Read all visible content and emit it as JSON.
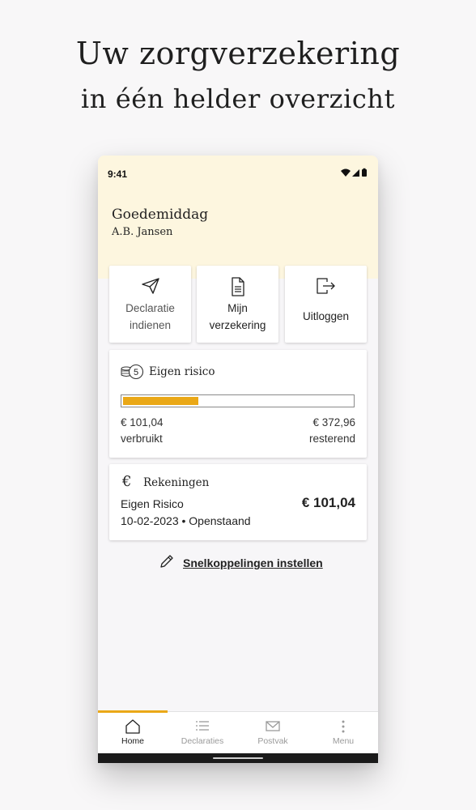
{
  "promo": {
    "line1": "Uw zorgverzekering",
    "line2": "in één helder overzicht"
  },
  "status_bar": {
    "time": "9:41",
    "icons": [
      "wifi-icon",
      "signal-icon",
      "battery-icon"
    ]
  },
  "header": {
    "greeting": "Goedemiddag",
    "user_name": "A.B. Jansen"
  },
  "quick_actions": [
    {
      "icon": "paper-plane-icon",
      "line1": "Declaratie",
      "line2": "indienen"
    },
    {
      "icon": "document-icon",
      "line1": "Mijn",
      "line2": "verzekering"
    },
    {
      "icon": "logout-icon",
      "label": "Uitloggen"
    }
  ],
  "eigen_risico": {
    "icon": "coins-icon",
    "icon_number": "5",
    "title": "Eigen risico",
    "used_amount": "€ 101,04",
    "used_label": "verbruikt",
    "remaining_amount": "€ 372,96",
    "remaining_label": "resterend",
    "progress_fraction": 0.33,
    "bar_color": "#eaa817"
  },
  "rekeningen": {
    "icon": "euro-icon",
    "title": "Rekeningen",
    "item_name": "Eigen Risico",
    "item_amount": "€ 101,04",
    "item_meta": "10-02-2023 • Openstaand"
  },
  "shortcut": {
    "icon": "pencil-icon",
    "label": "Snelkoppelingen instellen"
  },
  "bottom_nav": {
    "active": "Home",
    "items": [
      {
        "icon": "home-icon",
        "label": "Home"
      },
      {
        "icon": "list-icon",
        "label": "Declaraties"
      },
      {
        "icon": "envelope-icon",
        "label": "Postvak"
      },
      {
        "icon": "more-vertical-icon",
        "label": "Menu"
      }
    ]
  },
  "colors": {
    "accent": "#eaa817",
    "header_background": "#fdf6df",
    "page_background": "#f8f7f8"
  }
}
